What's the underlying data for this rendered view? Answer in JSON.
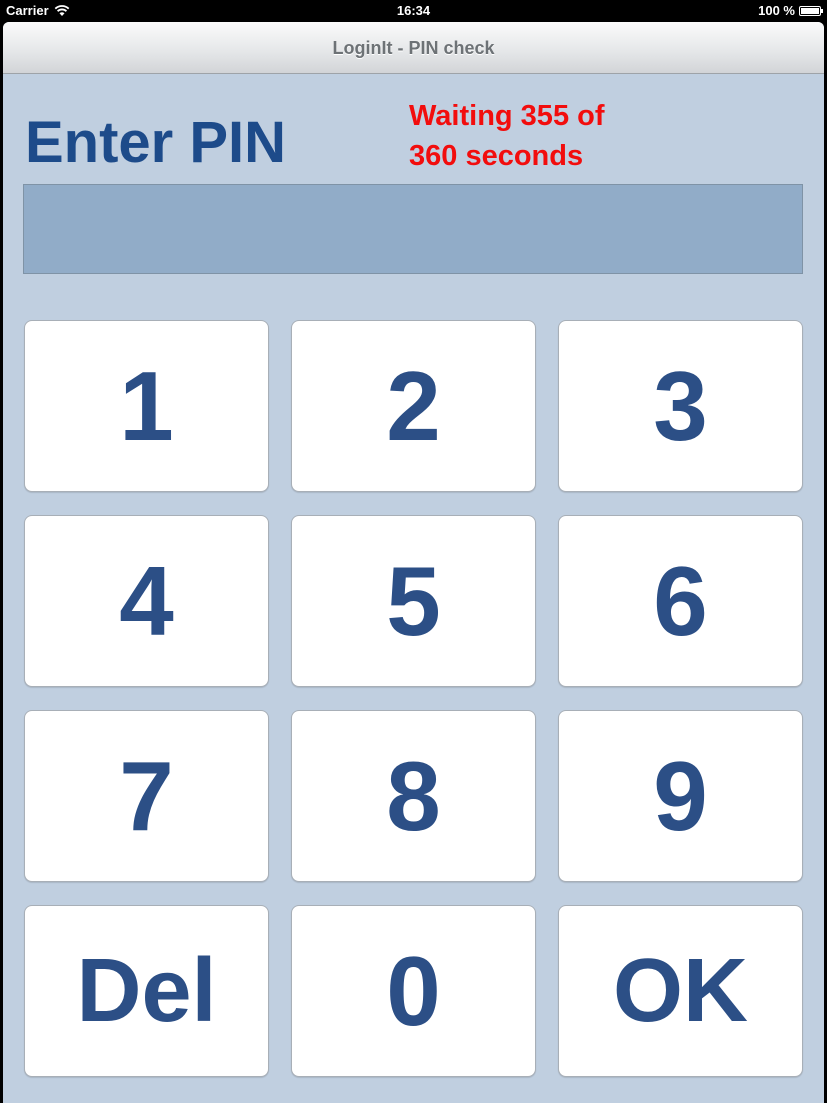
{
  "status_bar": {
    "carrier": "Carrier",
    "time": "16:34",
    "battery": "100 %",
    "icons": [
      "wifi-icon",
      "battery-icon"
    ]
  },
  "nav": {
    "title": "LoginIt - PIN check"
  },
  "main": {
    "heading": "Enter PIN",
    "wait_line1": "Waiting 355 of",
    "wait_line2": "360 seconds",
    "pin_value": ""
  },
  "keypad": {
    "keys": [
      "1",
      "2",
      "3",
      "4",
      "5",
      "6",
      "7",
      "8",
      "9",
      "Del",
      "0",
      "OK"
    ]
  },
  "colors": {
    "background": "#c0cfe0",
    "heading": "#1d4b8a",
    "key_text": "#2c4f86",
    "warning": "#f20d0d",
    "pin_field": "#91acc8"
  }
}
